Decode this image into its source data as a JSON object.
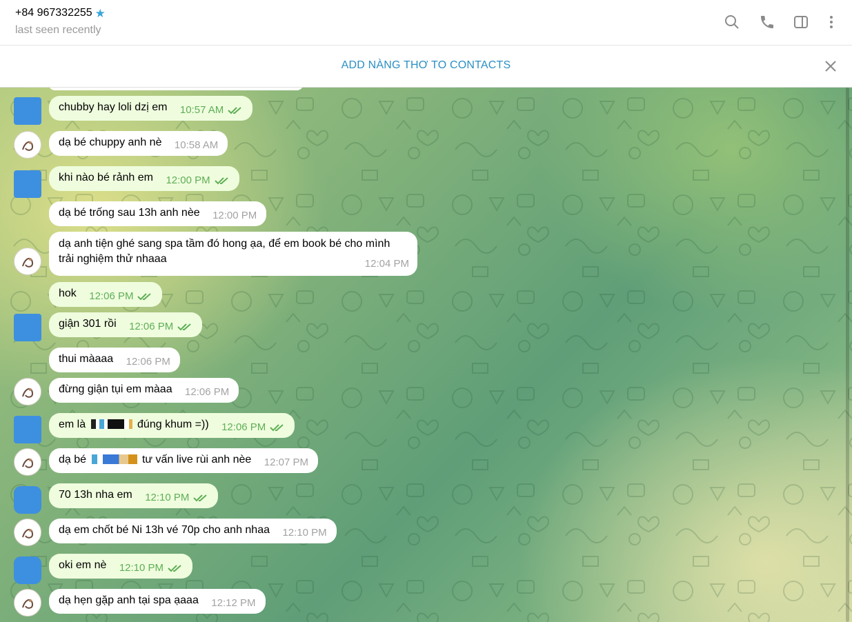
{
  "header": {
    "phone": "+84 967332255",
    "status": "last seen recently"
  },
  "contact_bar": {
    "add_label": "ADD NÀNG THƠ TO CONTACTS"
  },
  "messages": [
    {
      "dir": "out",
      "text": "chubby hay loli dzị em",
      "time": "10:57 AM"
    },
    {
      "dir": "in",
      "text": "dạ bé chuppy anh nè",
      "time": "10:58 AM"
    },
    {
      "dir": "out",
      "text": "khi nào bé rảnh em",
      "time": "12:00 PM"
    },
    {
      "dir": "in",
      "text": "dạ bé trống sau 13h anh nèe",
      "time": "12:00 PM"
    },
    {
      "dir": "in",
      "line1": "dạ anh tiện ghé sang spa tầm đó hong ạa, để em book bé cho mình",
      "line2": "trải nghiệm thử nhaaa",
      "time": "12:04 PM"
    },
    {
      "dir": "out",
      "text": "hok",
      "time": "12:06 PM"
    },
    {
      "dir": "out",
      "text": "giận 301 rồi",
      "time": "12:06 PM"
    },
    {
      "dir": "in",
      "text": "thui màaaa",
      "time": "12:06 PM"
    },
    {
      "dir": "in",
      "text": "đừng giận tụi em màaa",
      "time": "12:06 PM"
    },
    {
      "dir": "out",
      "pre": "em là",
      "post": "đúng khum =))",
      "time": "12:06 PM"
    },
    {
      "dir": "in",
      "pre": "dạ bé",
      "post": "tư vấn live rùi anh nèe",
      "time": "12:07 PM"
    },
    {
      "dir": "out",
      "text": "70 13h nha em",
      "time": "12:10 PM"
    },
    {
      "dir": "in",
      "text": "dạ em chốt bé Ni 13h vé 70p cho anh nhaa",
      "time": "12:10 PM"
    },
    {
      "dir": "out",
      "text": "oki em nè",
      "time": "12:10 PM"
    },
    {
      "dir": "in",
      "text": "dạ hẹn gặp anh tại spa ạaaa",
      "time": "12:12 PM"
    }
  ],
  "colors": {
    "accent": "#2a8fc4",
    "outgoing_bubble": "#effdde",
    "read_check": "#5fae57",
    "avatar_blue": "#3d8fe0"
  },
  "icons": [
    "star-icon",
    "search-icon",
    "phone-icon",
    "sidebar-toggle-icon",
    "more-vertical-icon",
    "close-icon",
    "double-check-icon"
  ]
}
